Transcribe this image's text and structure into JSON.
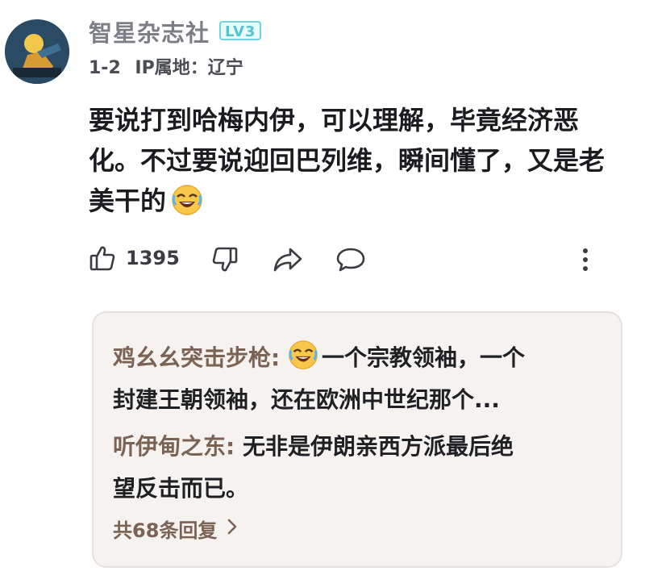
{
  "comment": {
    "user_name": "智星杂志社",
    "level": "LV3",
    "time": "1-2",
    "ip_location": "IP属地：辽宁",
    "text": "要说打到哈梅内伊，可以理解，毕竟经济恶化。不过要说迎回巴列维，瞬间懂了，又是老美干的",
    "text_emoji": "laughing-cry-emoji"
  },
  "actions": {
    "like_icon": "thumbs-up-icon",
    "like_count": "1395",
    "dislike_icon": "thumbs-down-icon",
    "share_icon": "share-icon",
    "comment_icon": "comment-icon",
    "more_icon": "more-vertical-icon"
  },
  "replies": [
    {
      "name": "鸡幺幺突击步枪",
      "separator": ": ",
      "emoji": "laughing-cry-emoji",
      "text_line1": "一个宗教领袖，一个",
      "text_line2": "封建王朝领袖，还在欧洲中世纪那个..."
    },
    {
      "name": "听伊甸之东",
      "separator": ": ",
      "text_line1": "无非是伊朗亲西方派最后绝",
      "text_line2": "望反击而已。"
    }
  ],
  "more_replies": {
    "label": "共68条回复",
    "icon": "chevron-right-icon"
  },
  "colors": {
    "username": "#7c7f86",
    "level_badge": "#4fc4d3",
    "reply_name": "#7a6355",
    "reply_card_bg": "#f5f2ef",
    "emoji_face": "#f7c84a"
  }
}
